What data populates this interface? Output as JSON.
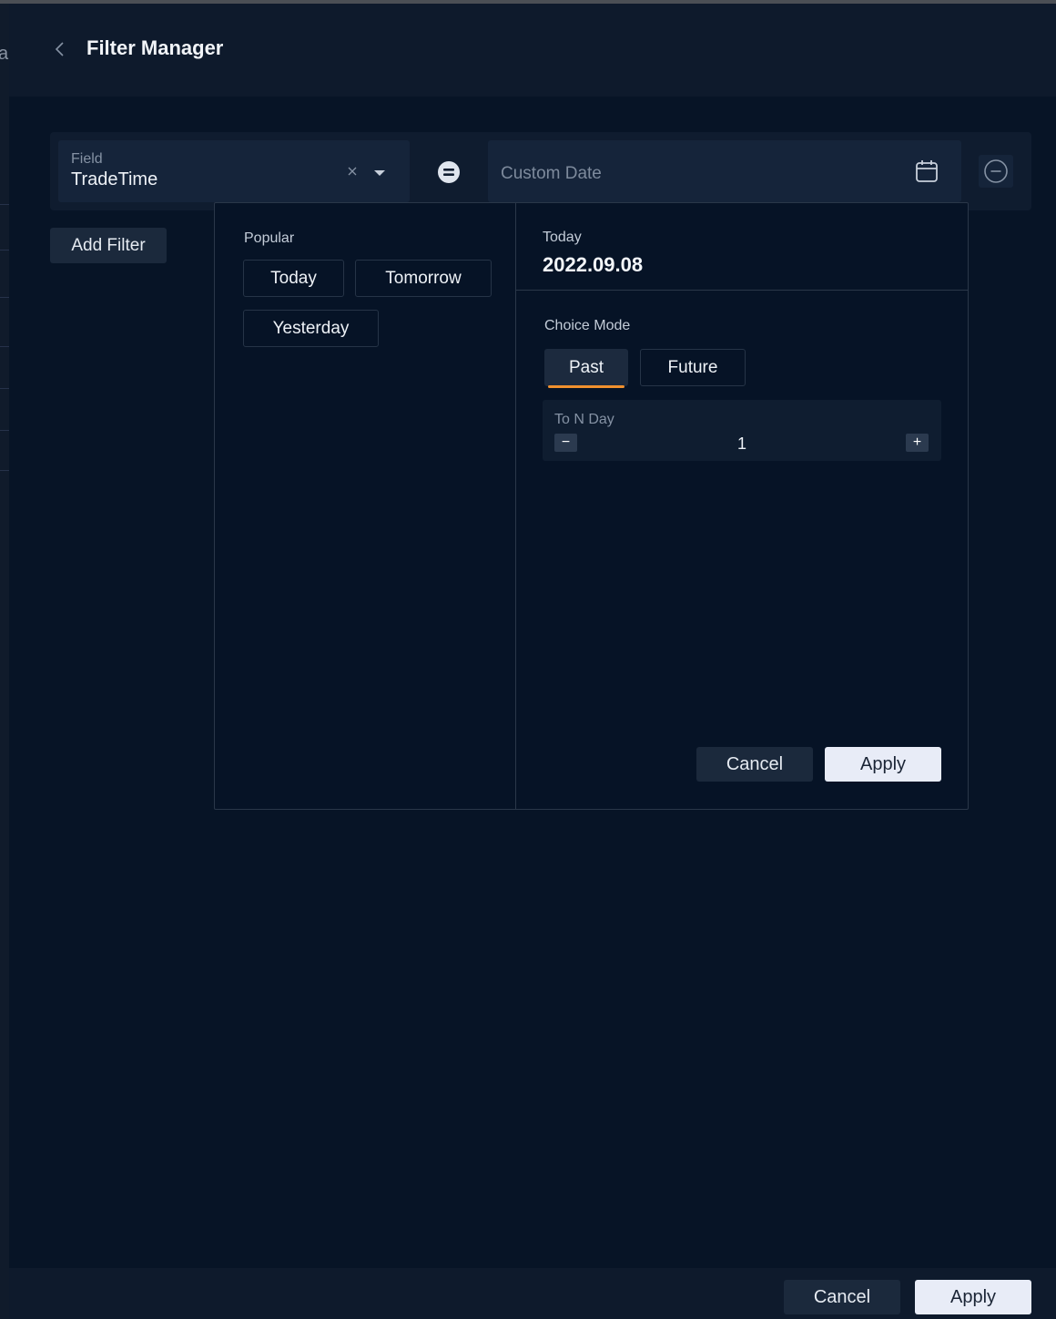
{
  "header": {
    "title": "Filter Manager",
    "left_fragment": "a"
  },
  "filter": {
    "field_label": "Field",
    "field_value": "TradeTime",
    "date_placeholder": "Custom Date"
  },
  "add_filter_label": "Add Filter",
  "popover": {
    "popular_label": "Popular",
    "popular_options": [
      "Today",
      "Tomorrow",
      "Yesterday"
    ],
    "today_label": "Today",
    "today_date": "2022.09.08",
    "choice_mode_label": "Choice Mode",
    "modes": [
      "Past",
      "Future"
    ],
    "selected_mode": "Past",
    "n_day_label": "To N Day",
    "n_day_value": "1",
    "minus_label": "−",
    "plus_label": "+",
    "cancel_label": "Cancel",
    "apply_label": "Apply"
  },
  "footer": {
    "cancel_label": "Cancel",
    "apply_label": "Apply"
  },
  "colors": {
    "background": "#071426",
    "panel": "#0e1a2c",
    "accent": "#f0902e",
    "apply_button": "#e8ecf7"
  }
}
